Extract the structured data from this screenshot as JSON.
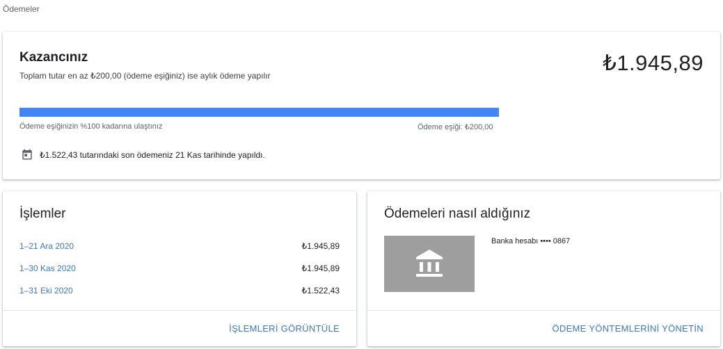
{
  "breadcrumb": "Ödemeler",
  "earnings": {
    "title": "Kazancınız",
    "subtitle": "Toplam tutar en az ₺200,00 (ödeme eşiğiniz) ise aylık ödeme yapılır",
    "amount": "₺1.945,89",
    "progress_percent": 100,
    "progress_left_label": "Ödeme eşiğinizin %100 kadarına ulaştınız",
    "progress_right_label": "Ödeme eşiği: ₺200,00",
    "last_payment_text": "₺1.522,43 tutarındaki son ödemeniz 21 Kas tarihinde yapıldı.",
    "calendar_icon": "calendar-icon",
    "progress_color": "#4285f4"
  },
  "transactions": {
    "title": "İşlemler",
    "rows": [
      {
        "period": "1–21 Ara 2020",
        "amount": "₺1.945,89"
      },
      {
        "period": "1–30 Kas 2020",
        "amount": "₺1.945,89"
      },
      {
        "period": "1–31 Eki 2020",
        "amount": "₺1.522,43"
      }
    ],
    "action_label": "İŞLEMLERİ GÖRÜNTÜLE"
  },
  "payment_methods": {
    "title": "Ödemeleri nasıl aldığınız",
    "bank_icon": "bank-icon",
    "bank_label": "Banka hesabı •••• 0867",
    "action_label": "ÖDEME YÖNTEMLERİNİ YÖNETİN"
  },
  "colors": {
    "link": "#3b78c2",
    "tile": "#9e9e9e"
  }
}
